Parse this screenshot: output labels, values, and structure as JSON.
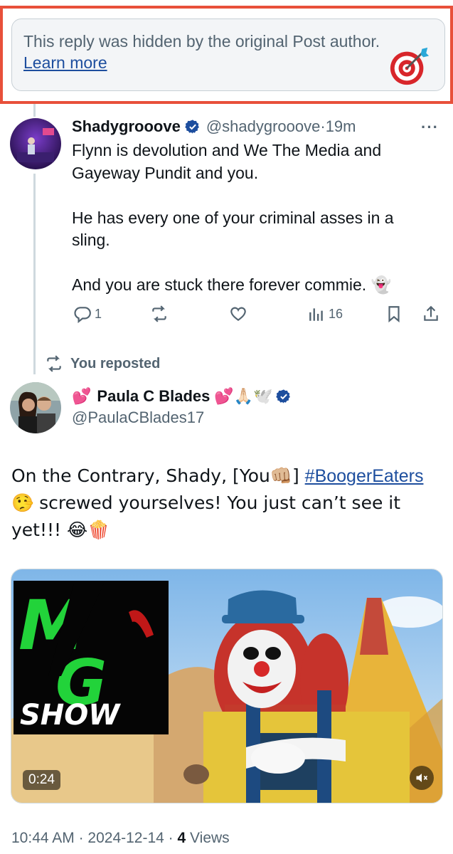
{
  "hidden_notice": {
    "text": "This reply was hidden by the original Post author.",
    "link": "Learn more"
  },
  "reply": {
    "display_name": "Shadygrooove",
    "handle": "@shadygrooove",
    "separator": "·",
    "time": "19m",
    "more": "···",
    "paragraphs": [
      "Flynn is devolution and We The Media and Gayeway Pundit and you.",
      "He has every one of your criminal asses in a sling.",
      "And you are stuck there forever commie. 👻"
    ],
    "actions": {
      "replies": "1",
      "reposts": "",
      "likes": "",
      "views": "16"
    }
  },
  "repost_label": "You reposted",
  "post": {
    "name_prefix_emoji": "💕",
    "display_name": "Paula C Blades",
    "name_suffix_emoji": "💕🙏🏻🕊️",
    "handle": "@PaulaCBlades17",
    "text_part1": "On the Contrary, Shady, [You👊🏼] ",
    "hashtag": "#BoogerEaters",
    "text_part2": " 🤥 screwed yourselves!  You just can’t see it yet!!! 😂🍿",
    "media": {
      "logo_letters": [
        "M",
        "G"
      ],
      "logo_word": "SHOW",
      "duration": "0:24"
    },
    "meta": {
      "time": "10:44 AM",
      "sep1": " · ",
      "date": "2024-12-14",
      "sep2": " · ",
      "views_count": "4",
      "views_label": " Views"
    }
  },
  "colors": {
    "banner_border": "#e8503a",
    "link": "#1d4e9e",
    "verified": "#1d4e9e",
    "muted": "#536471",
    "logo_green": "#22d33a"
  }
}
